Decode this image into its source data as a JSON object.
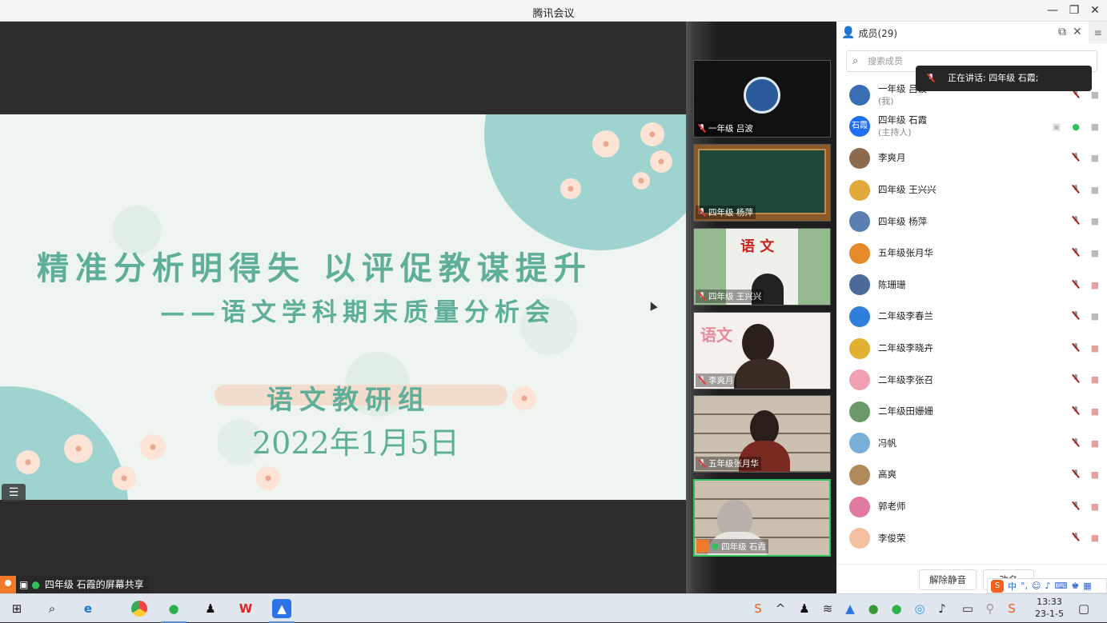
{
  "window": {
    "title": "腾讯会议",
    "minimize": "—",
    "restore": "❐",
    "close": "✕"
  },
  "slide": {
    "title": "精准分析明得失   以评促教谋提升",
    "subtitle": "——语文学科期末质量分析会",
    "group": "语文教研组",
    "date": "2022年1月5日",
    "menu_icon": "☰"
  },
  "share_label": "四年级  石霞的屏幕共享",
  "thumbnails": [
    {
      "name": "一年级 吕波"
    },
    {
      "name": "四年级 杨萍"
    },
    {
      "name": "四年级 王兴兴",
      "overlay": "语  文"
    },
    {
      "name": "李爽月",
      "overlay": "语文"
    },
    {
      "name": "五年级张月华"
    },
    {
      "name": "四年级  石霞"
    }
  ],
  "panel": {
    "title": "成员(29)",
    "search_placeholder": "搜索成员",
    "speaking": "正在讲话: 四年级  石霞;",
    "unmute_button": "解除静音",
    "rename_button": "改名",
    "members": [
      {
        "name": "一年级 吕波",
        "role": "(我)",
        "color": "#3a6fb5"
      },
      {
        "name": "四年级  石霞",
        "role": "(主持人)",
        "color": "#1f6ff0",
        "avatar_text": "石霞"
      },
      {
        "name": "李爽月",
        "color": "#8b6a4e"
      },
      {
        "name": "四年级 王兴兴",
        "color": "#e0a93a"
      },
      {
        "name": "四年级 杨萍",
        "color": "#5a7fb0"
      },
      {
        "name": "五年级张月华",
        "color": "#e58a2a"
      },
      {
        "name": "陈珊珊",
        "color": "#4a6a9a"
      },
      {
        "name": "二年级李春兰",
        "color": "#2d7fd8"
      },
      {
        "name": "二年级李晓卉",
        "color": "#e0b030"
      },
      {
        "name": "二年级李张召",
        "color": "#f0a0b0"
      },
      {
        "name": "二年级田姗姗",
        "color": "#6a9a6a"
      },
      {
        "name": "冯帆",
        "color": "#7ab0d8"
      },
      {
        "name": "高爽",
        "color": "#b08a5a"
      },
      {
        "name": "郭老师",
        "color": "#e07aa0"
      },
      {
        "name": "李俊荣",
        "color": "#f5c0a0"
      }
    ]
  },
  "taskbar": {
    "time": "13:33",
    "date": "23-1-5"
  },
  "ime": {
    "label": "中"
  }
}
